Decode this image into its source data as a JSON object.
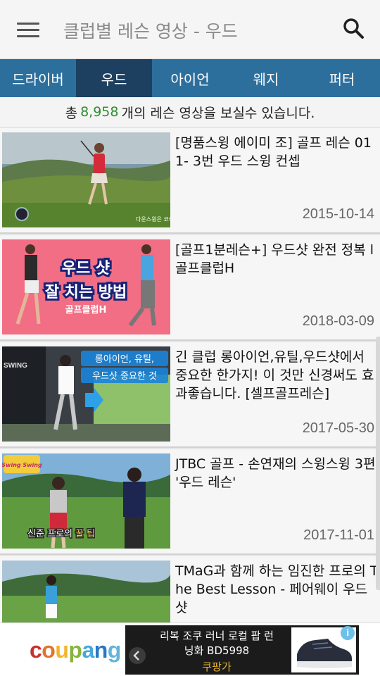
{
  "appbar": {
    "title": "클럽별 레슨 영상 - 우드",
    "menu_icon": "hamburger-menu-icon",
    "search_icon": "search-icon"
  },
  "tabs": [
    {
      "label": "드라이버",
      "active": false
    },
    {
      "label": "우드",
      "active": true
    },
    {
      "label": "아이언",
      "active": false
    },
    {
      "label": "웨지",
      "active": false
    },
    {
      "label": "퍼터",
      "active": false
    }
  ],
  "summary": {
    "prefix": "총",
    "count": "8,958",
    "suffix": "개의 레슨 영상을 보실수 있습니다."
  },
  "videos": [
    {
      "title": "[명품스윙 에이미 조] 골프 레슨 011- 3번 우드 스윙 컨셉",
      "date": "2015-10-14"
    },
    {
      "title": "[골프1분레슨+] 우드샷 완전 정복 l 골프클럽H",
      "date": "2018-03-09"
    },
    {
      "title": "긴 클럽 롱아이언,유틸,우드샷에서 중요한 한가지! 이 것만 신경써도 효과좋습니다. [셀프골프레슨]",
      "date": "2017-05-30"
    },
    {
      "title": "JTBC 골프 - 손연재의 스윙스윙 3편 '우드 레슨'",
      "date": "2017-11-01"
    },
    {
      "title": "TMaG과 함께 하는 임진한 프로의 The Best Lesson - 페어웨이 우드 샷",
      "date": ""
    }
  ],
  "thumb_text": {
    "t1_caption": "다운스윙은 코캐",
    "t2_line1": "우드 샷",
    "t2_line2": "잘 치는 방법",
    "t2_line3": "골프클럽H",
    "t3_line1": "롱아이언, 유틸,",
    "t3_line2": "우드샷 중요한 것",
    "t3_swing": "SWING",
    "t4_badge": "Swing Swing",
    "t4_caption1": "신준 프로의",
    "t4_caption2": "꿀 팁"
  },
  "ad": {
    "logo": "coupang",
    "line1": "리복 조쿠 러너 로컬 팝 런",
    "line2": "닝화 BD5998",
    "brand": "쿠팡가",
    "info_icon": "i",
    "colors": {
      "c": "#c8312f",
      "o": "#e27329",
      "u1": "#f3b32b",
      "p": "#89b340",
      "a": "#45a7dd",
      "n": "#2a77c4",
      "g": "#63b4d9"
    }
  }
}
